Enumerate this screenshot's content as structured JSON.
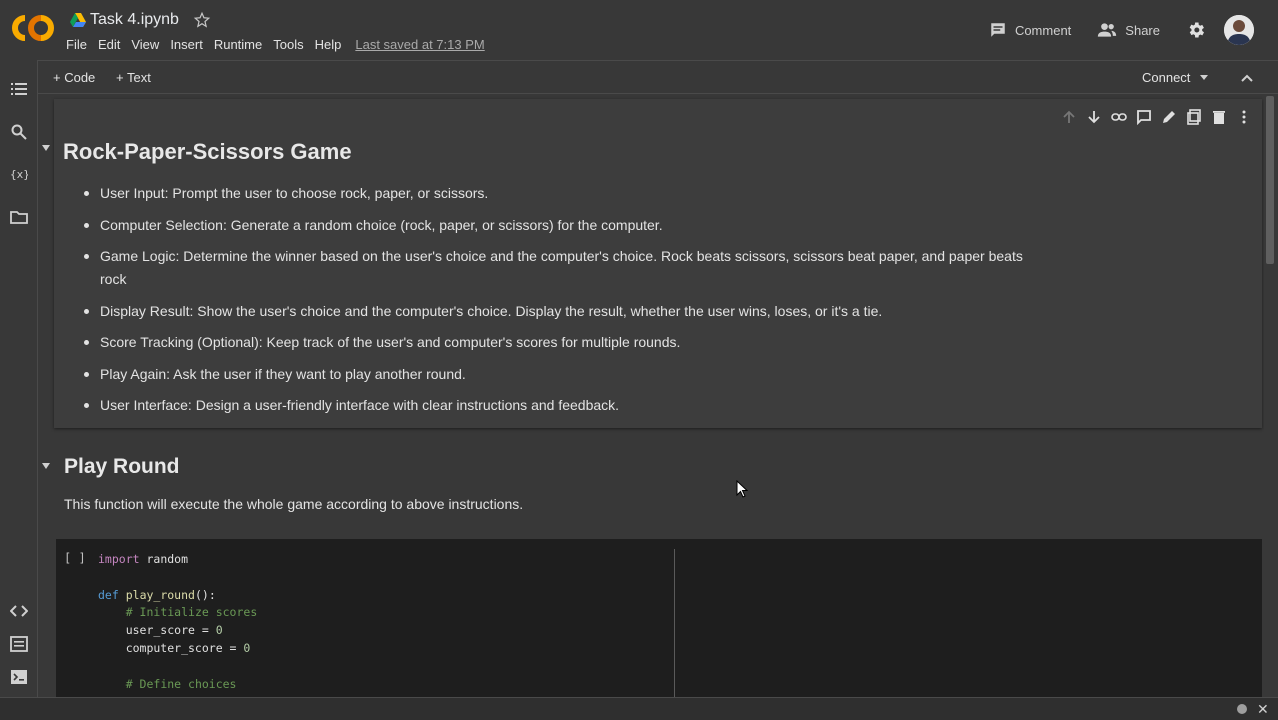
{
  "header": {
    "title": "Task 4.ipynb",
    "menu": [
      "File",
      "Edit",
      "View",
      "Insert",
      "Runtime",
      "Tools",
      "Help"
    ],
    "last_saved": "Last saved at 7:13 PM",
    "comment_label": "Comment",
    "share_label": "Share"
  },
  "toolbar": {
    "code_label": "+ Code",
    "text_label": "+ Text",
    "connect_label": "Connect"
  },
  "cells": {
    "heading1": "Rock-Paper-Scissors Game",
    "bullets": [
      "User Input: Prompt the user to choose rock, paper, or scissors.",
      "Computer Selection: Generate a random choice (rock, paper, or scissors) for the computer.",
      "Game Logic: Determine the winner based on the user's choice and the computer's choice. Rock beats scissors, scissors beat paper, and paper beats rock",
      "Display Result: Show the user's choice and the computer's choice. Display the result, whether the user wins, loses, or it's a tie.",
      "Score Tracking (Optional): Keep track of the user's and computer's scores for multiple rounds.",
      "Play Again: Ask the user if they want to play another round.",
      "User Interface: Design a user-friendly interface with clear instructions and feedback."
    ],
    "heading2": "Play Round",
    "paragraph": "This function will execute the whole game according to above instructions.",
    "run_indicator": "[ ]",
    "code_lines": [
      "import random",
      "",
      "def play_round():",
      "    # Initialize scores",
      "    user_score = 0",
      "    computer_score = 0",
      "",
      "    # Define choices"
    ]
  },
  "colors": {
    "background": "#383838",
    "cell_background": "#3d3d3d",
    "code_background": "#1e1e1e",
    "logo_orange": "#f9ab00",
    "logo_orange_dark": "#e37400"
  },
  "icons": [
    "colab-logo",
    "drive-icon",
    "star-icon",
    "comment-icon",
    "share-icon",
    "gear-icon",
    "toc-icon",
    "search-icon",
    "variables-icon",
    "files-icon",
    "code-snippets-icon",
    "command-palette-icon",
    "terminal-icon"
  ]
}
